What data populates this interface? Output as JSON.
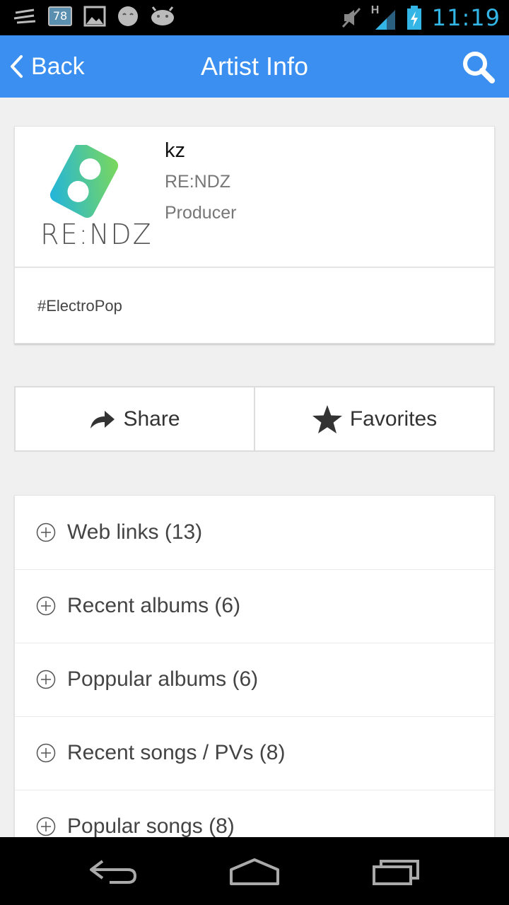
{
  "status_bar": {
    "battery_badge": "78",
    "network_label": "H",
    "time": "11:19",
    "icons": [
      "signal-strength-icon",
      "notification-badge-icon",
      "image-notification-icon",
      "face-notification-icon",
      "android-notification-icon",
      "muted-icon",
      "cell-signal-icon",
      "battery-charging-icon"
    ]
  },
  "action_bar": {
    "back_label": "Back",
    "title": "Artist Info",
    "background_color": "#3a8ff0"
  },
  "artist": {
    "name": "kz",
    "circle": "RE:NDZ",
    "role": "Producer",
    "tag": "#ElectroPop",
    "logo_text": "RE:NDZ"
  },
  "actions": {
    "share_label": "Share",
    "favorites_label": "Favorites"
  },
  "sections": [
    {
      "label": "Web links (13)"
    },
    {
      "label": "Recent albums (6)"
    },
    {
      "label": "Poppular albums (6)"
    },
    {
      "label": "Recent songs / PVs (8)"
    },
    {
      "label": "Popular songs (8)"
    }
  ]
}
